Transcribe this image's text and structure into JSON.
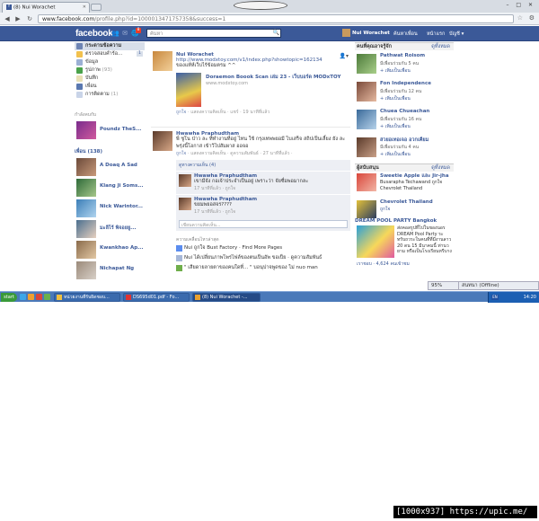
{
  "browser": {
    "tab_title": "(8) Nui Worachet",
    "url_host": "www.facebook.com",
    "url_path": "/profile.php?id=1000013471757358&success=1",
    "window_controls": "– □ ✕"
  },
  "fb": {
    "logo": "facebook",
    "notif_count": "8",
    "search_placeholder": "ค้นหา",
    "user_name": "Nui Worachet",
    "nav_find": "ค้นหาเพื่อน",
    "nav_home": "หน้าแรก",
    "nav_account": "บัญชี ▾"
  },
  "left": {
    "nav": [
      {
        "label": "กระดานข้อความ",
        "count": ""
      },
      {
        "label": "ตรวจสอบคำร้อ...",
        "count": "1"
      },
      {
        "label": "ข้อมูล",
        "count": ""
      },
      {
        "label": "รูปภาพ",
        "count": "(93)"
      },
      {
        "label": "บันทึก",
        "count": ""
      },
      {
        "label": "เพื่อน",
        "count": ""
      },
      {
        "label": "การติดตาม",
        "count": "(1)"
      }
    ],
    "groups_heading": "กำลังคบกับ",
    "group_name": "Poundz TheS...",
    "friends_heading": "เพื่อน (138)",
    "friends": [
      "A Doaq A Sad",
      "Klang Ji Soms...",
      "Nick Warintor...",
      "มะลิไร้ พิจอยยู...",
      "Kwankhao Ap...",
      "Nichapat Ng"
    ]
  },
  "feed": {
    "post1": {
      "author": "Nui Worachet",
      "link": "http://www.modxtoy.com/v1/index.php?showtopic=162134",
      "text": "ของแท้ห์เว็บไร้ข้อมตรม ^^",
      "attach_title": "Doraemon Boook Scan เล่ม 23 - เว็บบอร์ด MODxTOY",
      "attach_domain": "www.modxtoy.com",
      "meta_like": "ถูกใจ",
      "meta_rest": " · แสดงความคิดเห็น · แชร์ · 19 นาทีที่แล้ว"
    },
    "post2": {
      "author": "Hwawha Praphudtham",
      "text": "พี่ ชูโน ป่าว ละ ที่ทำงานที่อยู่ ไทน ใช้ กรุงเทพพยอมี ไบเสร็จ สถิปเป็นเลี้ยง ยัง ละ พรุ่งนี้โอกาส เข้าวิไปสัมผาส ออจอ",
      "meta_like": "ถูกใจ",
      "meta_rest": " · แสดงความคิดเห็น · ดูความสัมพันธ์ · 27 นาทีที่แล้ว ·",
      "likes": "ดูทางความเห็น (4)",
      "comments": [
        {
          "name": "Hwawha Praphudtham",
          "text": "เขามีจัง กอเจ้าประจำเป็นอยู่ เพราะว่า จัยซื่อพอมากละ",
          "meta": "17 นาทีที่แล้ว · ถูกใจ"
        },
        {
          "name": "Hwawha Praphudtham",
          "text": "ขยมพยอสจร????",
          "meta": "17 นาทีที่แล้ว · ถูกใจ"
        }
      ],
      "write_placeholder": "เขียนความคิดเห็น..."
    },
    "recent_heading": "ความเคลื่อนไหวล่าสุด",
    "recent": [
      {
        "text": "Nui ถูกใจ Bust Factory · Find More Pages"
      },
      {
        "text": "Nui ได้เปลี่ยนภาพโพรไฟล์ของตนเป็นอัพ ขอเป็ย · ดูความสัมพันธ์"
      },
      {
        "text": "\" เสียดายลายตาของคนใดที่... \" บอนุปาจพูดของ ไม่ nuo man"
      }
    ]
  },
  "right": {
    "suggest_heading": "คนที่คุณอาจรู้จัก",
    "see_all": "ดูทั้งหมด",
    "suggestions": [
      {
        "name": "Pathwat Roisom",
        "mutual": "มีเพื่อนร่วมกัน 5 คน",
        "add": "เพิ่มเป็นเพื่อน"
      },
      {
        "name": "Fon Independence",
        "mutual": "มีเพื่อนร่วมกัน 12 คน",
        "add": "เพิ่มเป็นเพื่อน"
      },
      {
        "name": "Chuea Chueachan",
        "mutual": "มีเพื่อนร่วมกัน 16 คน",
        "add": "เพิ่มเป็นเพื่อน"
      },
      {
        "name": "สวยอเทอเจอ อวกเคียม",
        "mutual": "มีเพื่อนร่วมกัน 4 คน",
        "add": "เพิ่มเป็นเพื่อน"
      }
    ],
    "sponsored_heading": "ผู้สนับสนุน",
    "sponsored_see_all": "ดูทั้งหมด",
    "sponsored": [
      {
        "title": "Sweetie Apple และ Jir-jha",
        "desc": "Busarapha Techawand ถูกใจ Chevrolet Thailand"
      },
      {
        "title": "Chevrolet Thailand",
        "desc": "ถูกใจ"
      }
    ],
    "ad": {
      "title": "DREAM POOL PARTY Bangkok",
      "desc": "ส่งคอลรูปที่ไปในของนอร DREAM Pool Party ระทรับถวระในคนที่ที่มีงานลาว 20 ดน 15 มีนาคมนี้ ท่านวยาม หรือเป็นโรงเรียนหรีบาง",
      "likes": "เราชอบ · 4,624 คนเข้าชม"
    },
    "chat_percent": "95%",
    "chat_status": "สนทนา (Offline)"
  },
  "taskbar": {
    "start": "start",
    "tasks": [
      "หน่วยงานที่รับผิดชอบ...",
      "DS695d01.pdf - Fo...",
      "(8) Nui Worachet -..."
    ],
    "lang": "EN",
    "clock": "14:20"
  },
  "footer": "[1000x937] https://upic.me/"
}
